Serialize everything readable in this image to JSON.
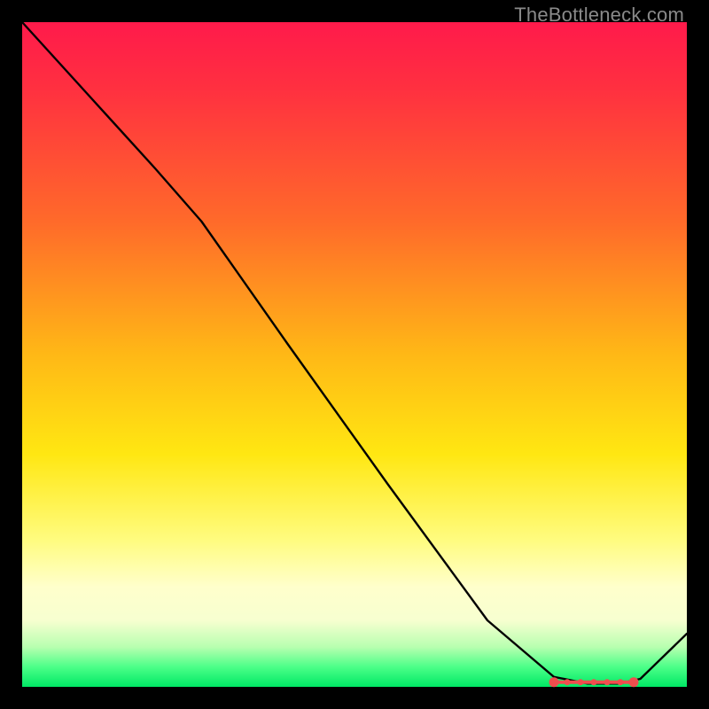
{
  "attribution": "TheBottleneck.com",
  "colors": {
    "curve": "#000000",
    "marker": "#ef4e4e"
  },
  "chart_data": {
    "type": "line",
    "title": "",
    "xlabel": "",
    "ylabel": "",
    "xlim": [
      0,
      100
    ],
    "ylim": [
      0,
      100
    ],
    "grid": false,
    "legend": false,
    "series": [
      {
        "name": "curve",
        "x": [
          0,
          10,
          20,
          27,
          40,
          55,
          70,
          80,
          85,
          90,
          93,
          100
        ],
        "y": [
          100,
          89,
          78,
          70,
          51.5,
          30.5,
          10,
          1.5,
          0.5,
          0.5,
          1.2,
          8
        ]
      }
    ],
    "markers": {
      "name": "highlight-band",
      "x": [
        80,
        82,
        84,
        86,
        88,
        90,
        92
      ],
      "y": [
        0.7,
        0.7,
        0.7,
        0.7,
        0.7,
        0.7,
        0.7
      ]
    }
  }
}
